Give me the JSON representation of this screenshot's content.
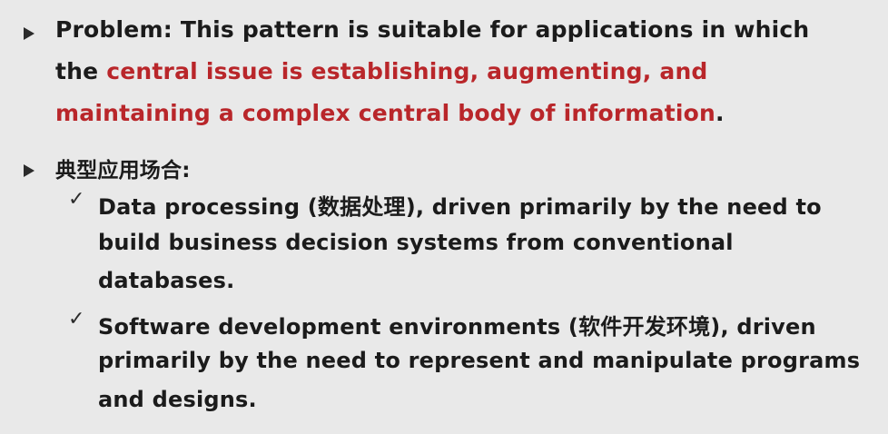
{
  "problem": {
    "label": "Problem:",
    "text1": "This pattern is suitable for applications in which",
    "text2_start": "the",
    "text2_red": "central issue is establishing, augmenting, and",
    "text3_red": "maintaining a complex central body of information",
    "text3_end": "."
  },
  "typical": {
    "heading": "典型应用场合:",
    "items": [
      {
        "line1": "Data processing (数据处理), driven primarily by the need to",
        "line2": "build business decision systems from conventional",
        "line3": "databases."
      },
      {
        "line1": "Software development environments (软件开发环境), driven",
        "line2": "primarily by the need to represent and manipulate programs",
        "line3": "and designs."
      }
    ]
  },
  "colors": {
    "highlight": "#b9262a",
    "text": "#1b1b1b",
    "background": "#e9e9e9"
  },
  "icons": {
    "bullet": "arrowhead-bullet",
    "sub_bullet": "checkmark"
  }
}
